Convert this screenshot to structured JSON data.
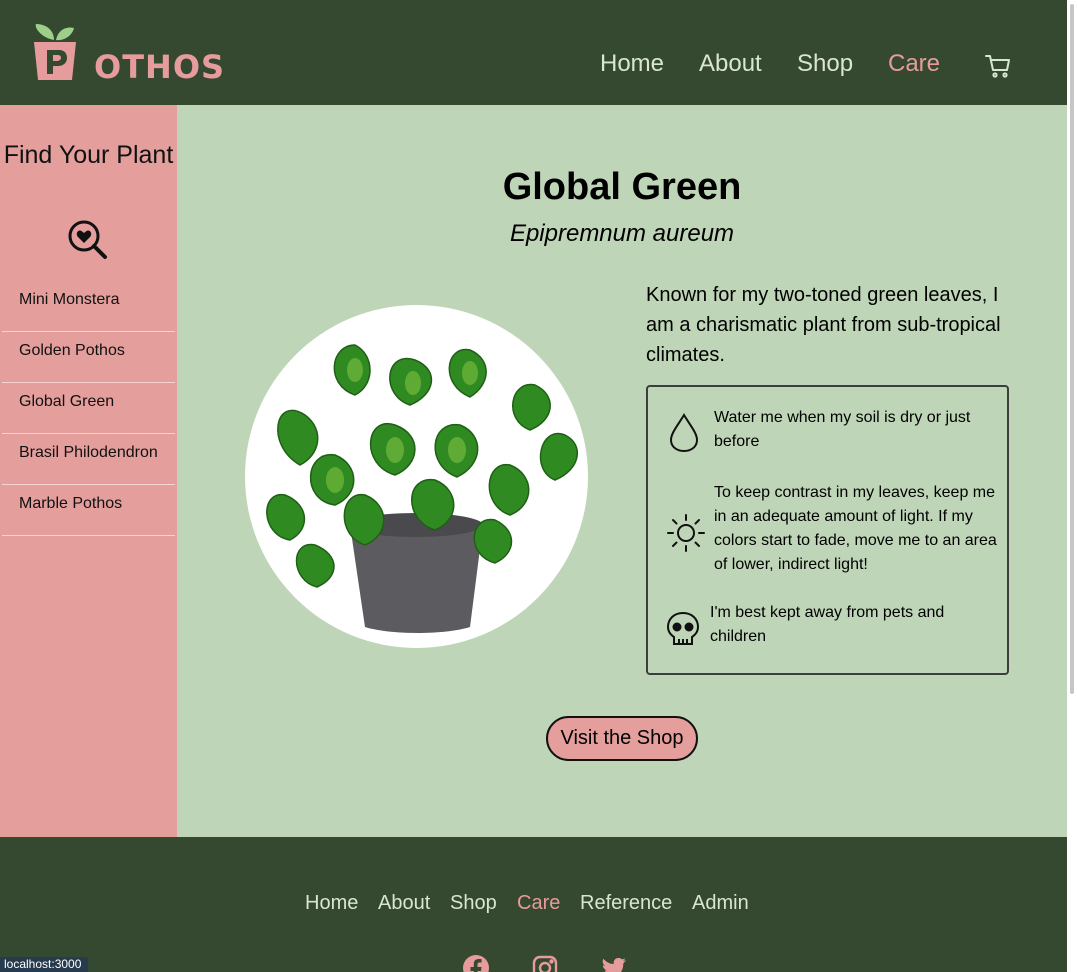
{
  "brand": {
    "logo_text": "OTHOS",
    "logo_initial": "P",
    "name": "Pothos"
  },
  "nav": {
    "items": [
      {
        "label": "Home",
        "active": false
      },
      {
        "label": "About",
        "active": false
      },
      {
        "label": "Shop",
        "active": false
      },
      {
        "label": "Care",
        "active": true
      }
    ],
    "cart_icon": "cart-icon"
  },
  "sidebar": {
    "title": "Find Your Plant",
    "search_icon": "heart-search-icon",
    "items": [
      {
        "label": "Mini Monstera"
      },
      {
        "label": "Golden Pothos"
      },
      {
        "label": "Global Green"
      },
      {
        "label": "Brasil Philodendron"
      },
      {
        "label": "Marble Pothos"
      }
    ]
  },
  "plant": {
    "name": "Global Green",
    "scientific_name": "Epipremnum aureum",
    "description": "Known for my two-toned green leaves, I am a charismatic plant from sub-tropical climates.",
    "care": [
      {
        "icon": "water-drop-icon",
        "text": "Water me when my soil is dry or just before"
      },
      {
        "icon": "sun-icon",
        "text": "To keep contrast in my leaves, keep me in an adequate amount of light. If my colors start to fade, move me to an area of lower, indirect light!"
      },
      {
        "icon": "skull-icon",
        "text": "I'm best kept away from pets and children"
      }
    ],
    "cta": "Visit the Shop"
  },
  "footer": {
    "links": [
      {
        "label": "Home",
        "active": false
      },
      {
        "label": "About",
        "active": false
      },
      {
        "label": "Shop",
        "active": false
      },
      {
        "label": "Care",
        "active": true
      },
      {
        "label": "Reference",
        "active": false
      },
      {
        "label": "Admin",
        "active": false
      }
    ],
    "social": [
      "facebook-icon",
      "instagram-icon",
      "twitter-icon"
    ]
  },
  "status_bar": "localhost:3000",
  "colors": {
    "header_bg": "#354830",
    "sidebar_bg": "#e49f9d",
    "main_bg": "#bfd5b7",
    "accent": "#e69c9c",
    "nav_text": "#d8e6d2"
  }
}
